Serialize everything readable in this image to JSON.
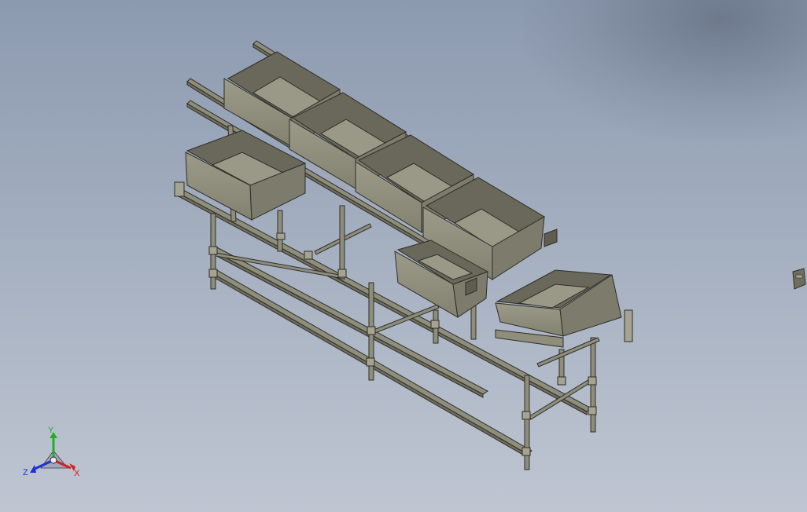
{
  "viewport": {
    "background_top": "#8c9ab0",
    "background_bottom": "#bfc6d2",
    "model": {
      "icon": "conveyor-bin-frame-model",
      "bin_count": 6,
      "steel_color": "#8f8d7c",
      "shade_color": "#6f6d5e",
      "edge_color": "#2e2e28"
    }
  },
  "triad": {
    "x_label": "X",
    "y_label": "Y",
    "z_label": "Z",
    "x_color": "#d42020",
    "y_color": "#21b021",
    "z_color": "#2030d0"
  }
}
